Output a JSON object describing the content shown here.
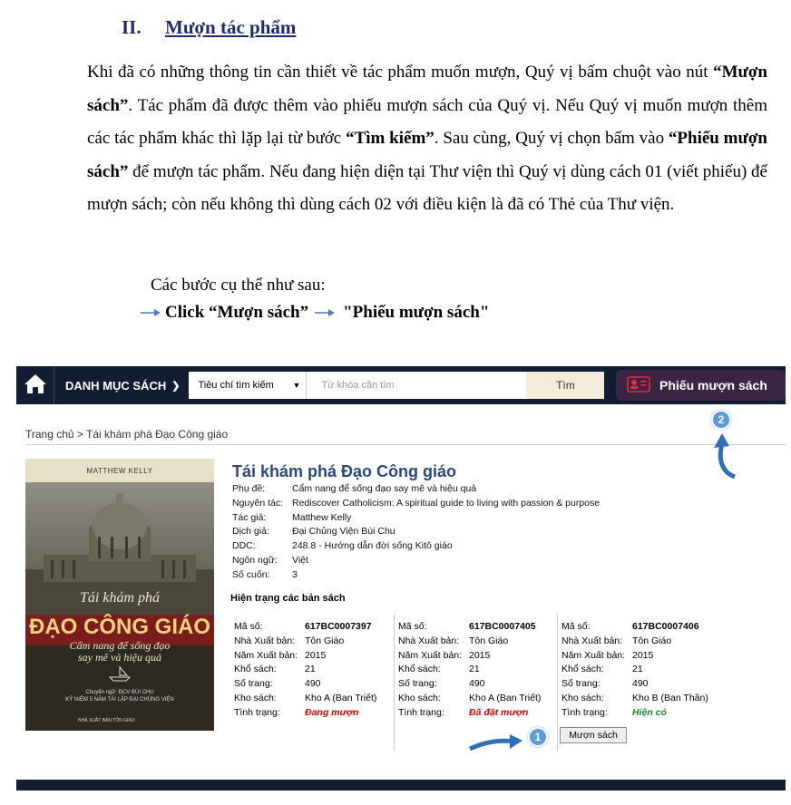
{
  "section": {
    "number": "II.",
    "title": "Mượn tác phẩm"
  },
  "paragraph": {
    "p1": "Khi đã có những thông tin cần thiết về tác phẩm muốn mượn, Quý vị bấm chuột vào nút ",
    "b1": "“Mượn sách”",
    "p2": ". Tác phẩm đã được thêm vào phiếu mượn sách của Quý vị. Nếu Quý vị muốn mượn thêm các tác phẩm khác thì lặp lại từ bước ",
    "b2": "“Tìm kiếm”",
    "p3": ". Sau cùng, Quý vị chọn bấm vào ",
    "b3": "“Phiếu mượn sách”",
    "p4": " để mượn tác phẩm. Nếu đang hiện diện tại Thư viện thì Quý vị dùng cách 01 (viết phiếu) để mượn sách; còn nếu không thì dùng cách 02 với điều kiện là đã có Thẻ của Thư viện."
  },
  "steps": {
    "intro": "Các bước cụ thể như sau:",
    "step1": "Click “Mượn sách”",
    "step2": "\"Phiếu mượn sách\""
  },
  "colors": {
    "navbar": "#131d32",
    "loan_button": "#3b2444",
    "badge": "#5b9bd5",
    "heading": "#1f2a6b",
    "title_blue": "#2a4a7a"
  },
  "screenshot": {
    "nav": {
      "home_icon": "home-icon",
      "catalog_label": "DANH MỤC SÁCH",
      "criteria_label": "Tiêu chí tìm kiếm",
      "keyword_placeholder": "Từ khóa cần tìm",
      "search_label": "Tìm",
      "loan_label": "Phiếu mượn sách"
    },
    "breadcrumb": "Trang chủ > Tái khám phá Đạo Công giáo",
    "badges": {
      "one": "1",
      "two": "2"
    },
    "cover": {
      "author": "MATTHEW KELLY",
      "italic_title": "Tái khám phá",
      "main_title": "ĐẠO CÔNG GIÁO",
      "subtitle_1": "Cẩm nang để sống đạo",
      "subtitle_2": "say mê và hiệu quả",
      "fine_1": "Chuyển ngữ: ĐCV BÙI CHU",
      "fine_2": "KỶ NIỆM 5 NĂM TÁI LẬP ĐẠI CHỦNG VIỆN",
      "publisher": "NHÀ XUẤT BẢN TÔN GIÁO"
    },
    "book": {
      "title": "Tái khám phá Đạo Công giáo",
      "meta": [
        {
          "k": "Phụ đề:",
          "v": "Cẩm nang để sống đạo say mê và hiệu quả"
        },
        {
          "k": "Nguyên tác:",
          "v": "Rediscover Catholicism: A spiritual guide to living with passion & purpose"
        },
        {
          "k": "Tác giả:",
          "v": "Matthew Kelly"
        },
        {
          "k": "Dịch giả:",
          "v": "Đại Chủng Viện Bùi Chu"
        },
        {
          "k": "DDC:",
          "v": "248.8 - Hướng dẫn đời sống Kitô giáo"
        },
        {
          "k": "Ngôn ngữ:",
          "v": "Việt"
        },
        {
          "k": "Số cuốn:",
          "v": "3"
        }
      ],
      "copies_heading": "Hiện trạng các bản sách",
      "labels": {
        "code": "Mã số:",
        "publisher": "Nhà Xuất bản:",
        "year": "Năm Xuất bản:",
        "size": "Khổ sách:",
        "pages": "Số trang:",
        "location": "Kho sách:",
        "status": "Tình trạng:"
      },
      "copies": [
        {
          "code": "617BC0007397",
          "publisher": "Tôn Giáo",
          "year": "2015",
          "size": "21",
          "pages": "490",
          "location": "Kho A (Ban Triết)",
          "status": "Đang mượn"
        },
        {
          "code": "617BC0007405",
          "publisher": "Tôn Giáo",
          "year": "2015",
          "size": "21",
          "pages": "490",
          "location": "Kho A (Ban Triết)",
          "status": "Đã đặt mượn"
        },
        {
          "code": "617BC0007406",
          "publisher": "Tôn Giáo",
          "year": "2015",
          "size": "21",
          "pages": "490",
          "location": "Kho B (Ban Thần)",
          "status": "Hiện có"
        }
      ],
      "borrow_label": "Mượn sách"
    }
  }
}
